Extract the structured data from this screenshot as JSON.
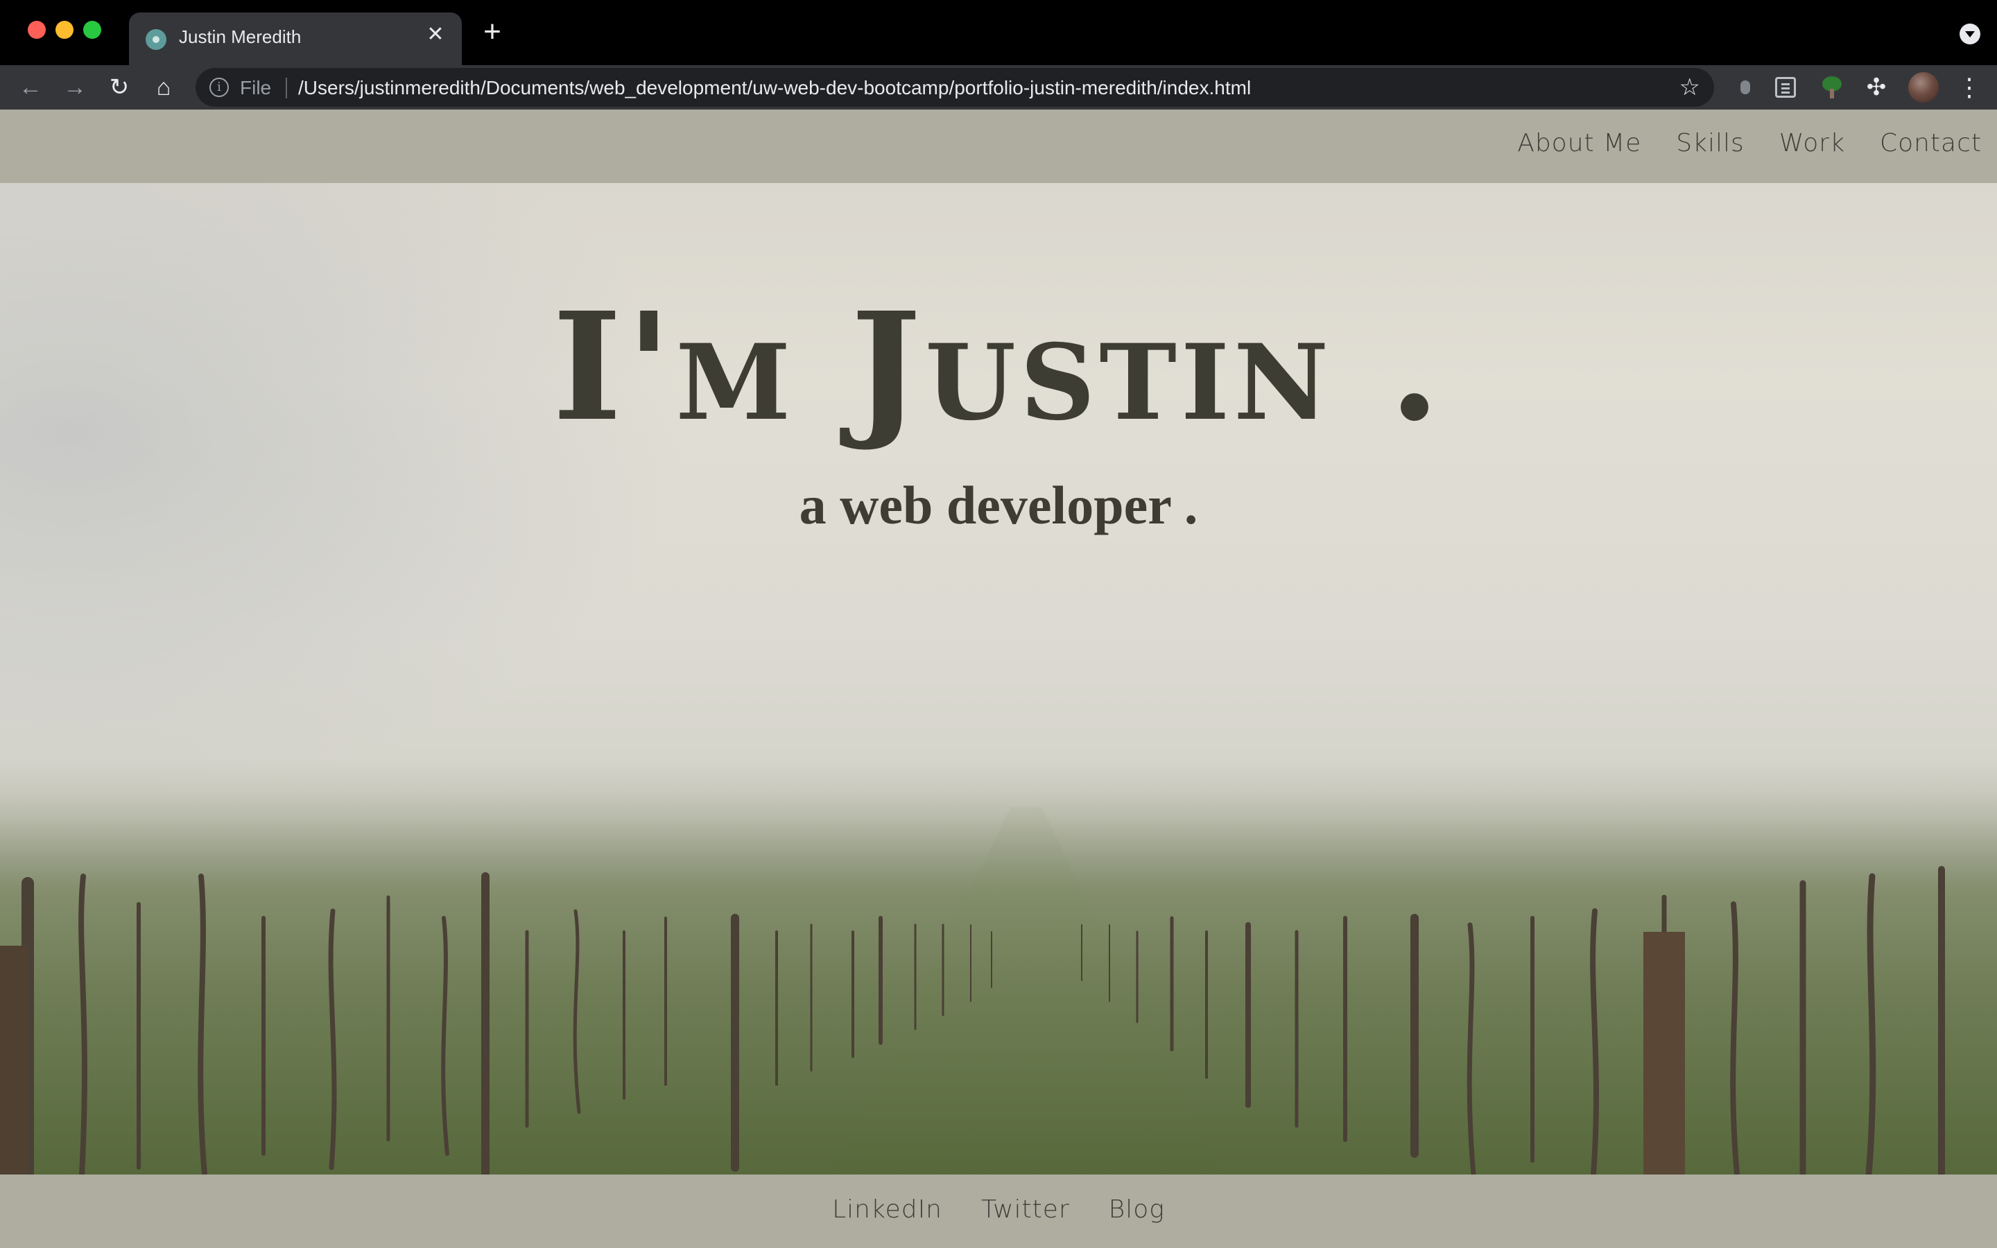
{
  "browser": {
    "tab_title": "Justin Meredith",
    "tab_close": "✕",
    "new_tab": "+",
    "address_scheme": "File",
    "address_url": "/Users/justinmeredith/Documents/web_development/uw-web-dev-bootcamp/portfolio-justin-meredith/index.html",
    "back_glyph": "←",
    "forward_glyph": "→",
    "reload_glyph": "↻",
    "home_glyph": "⌂",
    "star_glyph": "☆",
    "info_glyph": "i",
    "extensions_glyph": "✣",
    "menu_glyph": "⋮",
    "icons": [
      "back-icon",
      "forward-icon",
      "reload-icon",
      "home-icon",
      "info-icon",
      "bookmark-star-icon",
      "extension-icon",
      "reader-mode-icon",
      "tree-extension-icon",
      "puzzle-extensions-icon",
      "profile-avatar",
      "kebab-menu-icon"
    ]
  },
  "site": {
    "nav": [
      {
        "label": "About Me"
      },
      {
        "label": "Skills"
      },
      {
        "label": "Work"
      },
      {
        "label": "Contact"
      }
    ],
    "hero": {
      "title": "I'm Justin .",
      "subtitle": "a web developer ."
    },
    "footer": [
      {
        "label": "LinkedIn"
      },
      {
        "label": "Twitter"
      },
      {
        "label": "Blog"
      }
    ]
  },
  "colors": {
    "header_bg": "#aeada0",
    "text_dark": "#3e3d34",
    "chrome_dark": "#35363a"
  }
}
